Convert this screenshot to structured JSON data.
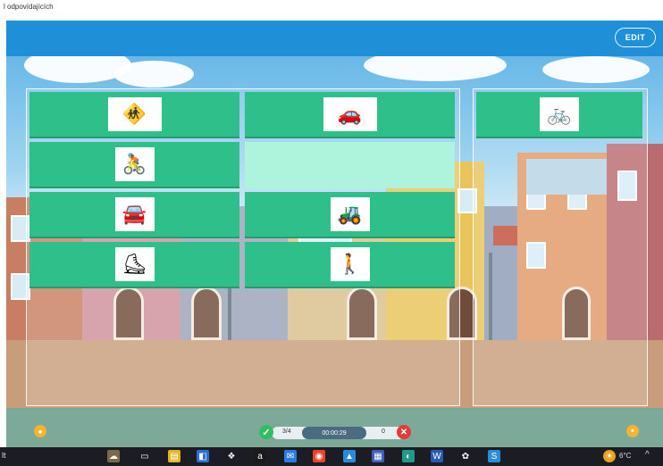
{
  "page": {
    "caption": "l odpovídajících"
  },
  "header": {
    "edit_label": "EDIT"
  },
  "cards": {
    "left": [
      {
        "icon": "crosswalk-icon",
        "glyph": "🚸"
      },
      {
        "icon": "street-car-icon",
        "glyph": "🚗"
      },
      {
        "icon": "cyclist-icon",
        "glyph": "🚴"
      },
      {
        "icon": "empty-slot",
        "glyph": ""
      },
      {
        "icon": "driver-icon",
        "glyph": "🚘"
      },
      {
        "icon": "tractor-icon",
        "glyph": "🚜"
      },
      {
        "icon": "skater-girl-icon",
        "glyph": "⛸"
      },
      {
        "icon": "walking-boy-icon",
        "glyph": "🚶"
      }
    ],
    "right": [
      {
        "icon": "boy-cyclist-icon",
        "glyph": "🚲"
      }
    ]
  },
  "status": {
    "correct": "3/4",
    "timer": "00:00:29",
    "wrong": "0"
  },
  "taskbar": {
    "left_text": "lt",
    "temperature": "6°C",
    "chevron": "^"
  },
  "colors": {
    "header": "#1f8fd8",
    "card": "#2fbf8a",
    "card_empty": "#aef3dc",
    "correct": "#2fbf63",
    "wrong": "#e23b3b"
  }
}
